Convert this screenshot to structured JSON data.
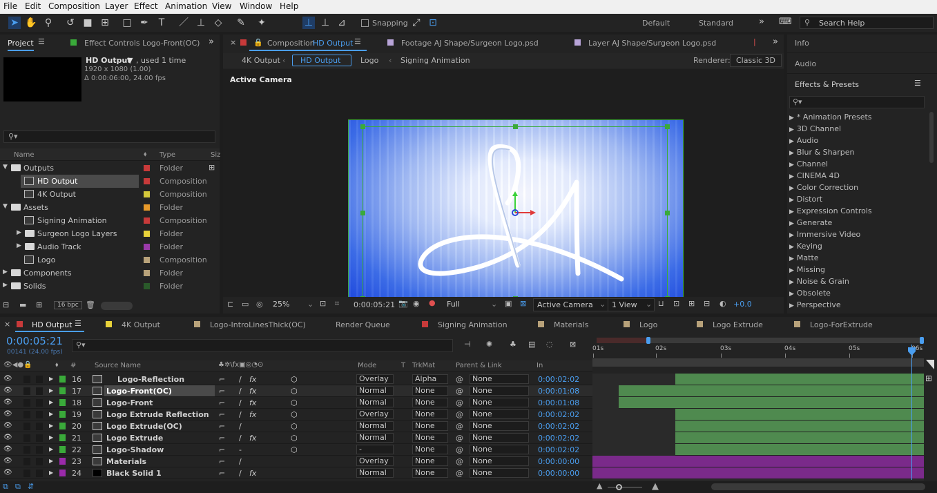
{
  "menu": [
    "File",
    "Edit",
    "Composition",
    "Layer",
    "Effect",
    "Animation",
    "View",
    "Window",
    "Help"
  ],
  "toolbar": {
    "snapping": "Snapping",
    "workspaces": [
      "Default",
      "Standard"
    ],
    "search_placeholder": "Search Help"
  },
  "project": {
    "tab": "Project",
    "effect_controls_tab": "Effect Controls Logo-Front(OC)",
    "item_name": "HD Output",
    "used": ", used 1 time",
    "res": "1920 x 1080 (1.00)",
    "dur": "Δ 0:00:06:00, 24.00 fps",
    "col_name": "Name",
    "col_type": "Type",
    "col_size": "Siz",
    "bpc": "16 bpc",
    "items": [
      {
        "name": "Outputs",
        "type": "Folder",
        "color": "#c83a3a"
      },
      {
        "name": "HD Output",
        "type": "Composition",
        "color": "#c83a3a"
      },
      {
        "name": "4K Output",
        "type": "Composition",
        "color": "#d4c83a"
      },
      {
        "name": "Assets",
        "type": "Folder",
        "color": "#e89a2a"
      },
      {
        "name": "Signing Animation",
        "type": "Composition",
        "color": "#c83a3a"
      },
      {
        "name": "Surgeon Logo Layers",
        "type": "Folder",
        "color": "#e8d23a"
      },
      {
        "name": "Audio Track",
        "type": "Folder",
        "color": "#9a3aaa"
      },
      {
        "name": "Logo",
        "type": "Composition",
        "color": "#b8a27a"
      },
      {
        "name": "Components",
        "type": "Folder",
        "color": "#b8a27a"
      },
      {
        "name": "Solids",
        "type": "Folder",
        "color": "#2a5a2a"
      }
    ]
  },
  "viewer": {
    "tab_prefix": "Composition",
    "tab_comp": "HD Output",
    "tab_footage": "Footage AJ Shape/Surgeon Logo.psd",
    "tab_layer": "Layer AJ Shape/Surgeon Logo.psd",
    "crumbs": [
      "4K Output",
      "HD Output",
      "Logo",
      "Signing Animation"
    ],
    "renderer_label": "Renderer:",
    "renderer": "Classic 3D",
    "active_camera": "Active Camera",
    "zoom": "25%",
    "time": "0:00:05:21",
    "quality": "Full",
    "camera": "Active Camera",
    "views": "1 View",
    "exposure": "+0.0"
  },
  "right": {
    "info": "Info",
    "audio": "Audio",
    "effects": "Effects & Presets",
    "list": [
      "* Animation Presets",
      "3D Channel",
      "Audio",
      "Blur & Sharpen",
      "Channel",
      "CINEMA 4D",
      "Color Correction",
      "Distort",
      "Expression Controls",
      "Generate",
      "Immersive Video",
      "Keying",
      "Matte",
      "Missing",
      "Noise & Grain",
      "Obsolete",
      "Perspective"
    ]
  },
  "timeline": {
    "tabs": [
      {
        "label": "HD Output",
        "color": "#c83a3a"
      },
      {
        "label": "4K Output",
        "color": "#e8d23a"
      },
      {
        "label": "Logo-IntroLinesThick(OC)",
        "color": "#b8a27a"
      },
      {
        "label": "Render Queue",
        "color": ""
      },
      {
        "label": "Signing Animation",
        "color": "#c83a3a"
      },
      {
        "label": "Materials",
        "color": "#b8a27a"
      },
      {
        "label": "Logo",
        "color": "#b8a27a"
      },
      {
        "label": "Logo Extrude",
        "color": "#b8a27a"
      },
      {
        "label": "Logo-ForExtrude",
        "color": "#b8a27a"
      }
    ],
    "timecode": "0:00:05:21",
    "frames": "00141 (24.00 fps)",
    "cols": {
      "num": "#",
      "source": "Source Name",
      "mode": "Mode",
      "t": "T",
      "trkmat": "TrkMat",
      "parent": "Parent & Link",
      "in": "In"
    },
    "ruler": [
      "01s",
      "02s",
      "03s",
      "04s",
      "05s",
      "06s"
    ],
    "layers": [
      {
        "num": "16",
        "name": "Logo-Reflection",
        "mode": "Overlay",
        "trk": "Alpha",
        "parent": "None",
        "in": "0:00:02:02",
        "color": "#3aaa3a",
        "start": 0.25
      },
      {
        "num": "17",
        "name": "Logo-Front(OC)",
        "mode": "Normal",
        "trk": "None",
        "parent": "None",
        "in": "0:00:01:08",
        "color": "#3aaa3a",
        "start": 0.08
      },
      {
        "num": "18",
        "name": "Logo-Front",
        "mode": "Normal",
        "trk": "None",
        "parent": "None",
        "in": "0:00:01:08",
        "color": "#3aaa3a",
        "start": 0.08
      },
      {
        "num": "19",
        "name": "Logo Extrude Reflection",
        "mode": "Overlay",
        "trk": "None",
        "parent": "None",
        "in": "0:00:02:02",
        "color": "#3aaa3a",
        "start": 0.25
      },
      {
        "num": "20",
        "name": "Logo Extrude(OC)",
        "mode": "Normal",
        "trk": "None",
        "parent": "None",
        "in": "0:00:02:02",
        "color": "#3aaa3a",
        "start": 0.25
      },
      {
        "num": "21",
        "name": "Logo Extrude",
        "mode": "Normal",
        "trk": "None",
        "parent": "None",
        "in": "0:00:02:02",
        "color": "#3aaa3a",
        "start": 0.25
      },
      {
        "num": "22",
        "name": "Logo-Shadow",
        "mode": "-",
        "trk": "None",
        "parent": "None",
        "in": "0:00:02:02",
        "color": "#3aaa3a",
        "start": 0.25
      },
      {
        "num": "23",
        "name": "Materials",
        "mode": "Overlay",
        "trk": "None",
        "parent": "None",
        "in": "0:00:00:00",
        "color": "#9a2aaa",
        "start": 0
      },
      {
        "num": "24",
        "name": "Black Solid 1",
        "mode": "Normal",
        "trk": "None",
        "parent": "None",
        "in": "0:00:00:00",
        "color": "#9a2aaa",
        "start": 0
      }
    ]
  }
}
